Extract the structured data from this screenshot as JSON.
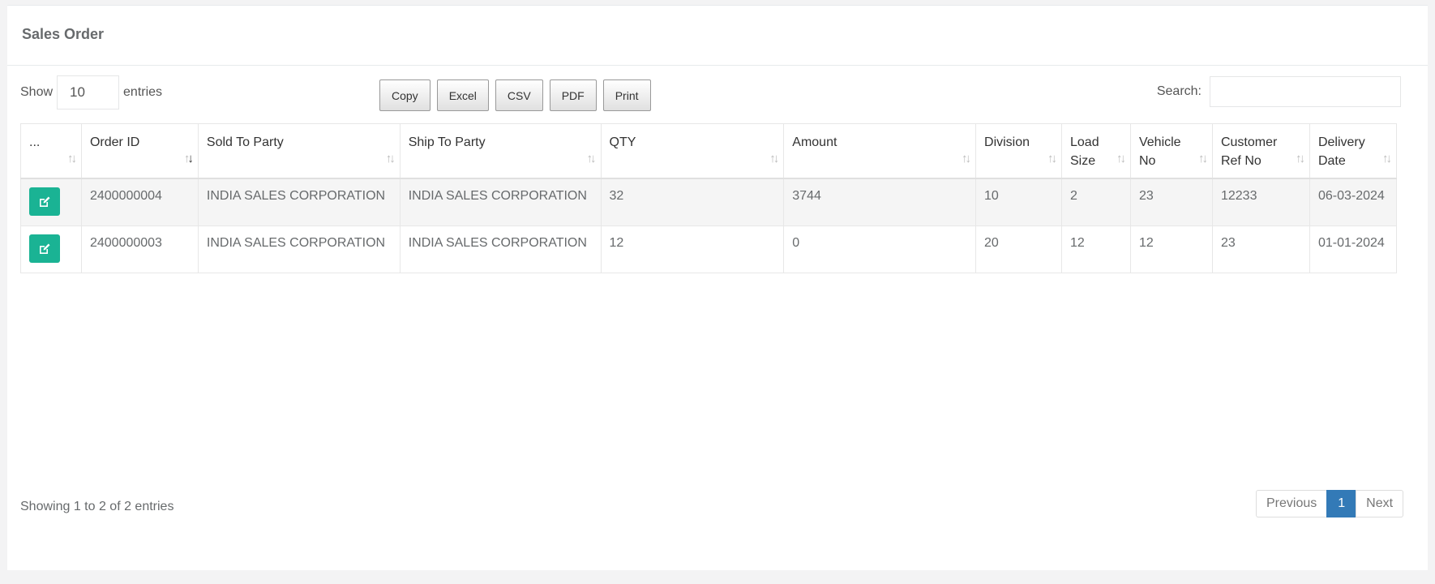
{
  "title": "Sales Order",
  "length": {
    "show_label": "Show",
    "value": "10",
    "entries_label": "entries"
  },
  "buttons": [
    "Copy",
    "Excel",
    "CSV",
    "PDF",
    "Print"
  ],
  "search": {
    "label": "Search:",
    "placeholder": ""
  },
  "columns": [
    "...",
    "Order ID",
    "Sold To Party",
    "Ship To Party",
    "QTY",
    "Amount",
    "Division",
    "Load Size",
    "Vehicle No",
    "Customer Ref No",
    "Delivery Date"
  ],
  "rows": [
    [
      "2400000004",
      "INDIA SALES CORPORATION",
      "INDIA SALES CORPORATION",
      "32",
      "3744",
      "10",
      "2",
      "23",
      "12233",
      "06-03-2024"
    ],
    [
      "2400000003",
      "INDIA SALES CORPORATION",
      "INDIA SALES CORPORATION",
      "12",
      "0",
      "20",
      "12",
      "12",
      "23",
      "01-01-2024"
    ]
  ],
  "info": "Showing 1 to 2 of 2 entries",
  "pagination": {
    "previous": "Previous",
    "current": "1",
    "next": "Next"
  },
  "colors": {
    "accent": "#1ab394",
    "page_active": "#337ab7"
  }
}
